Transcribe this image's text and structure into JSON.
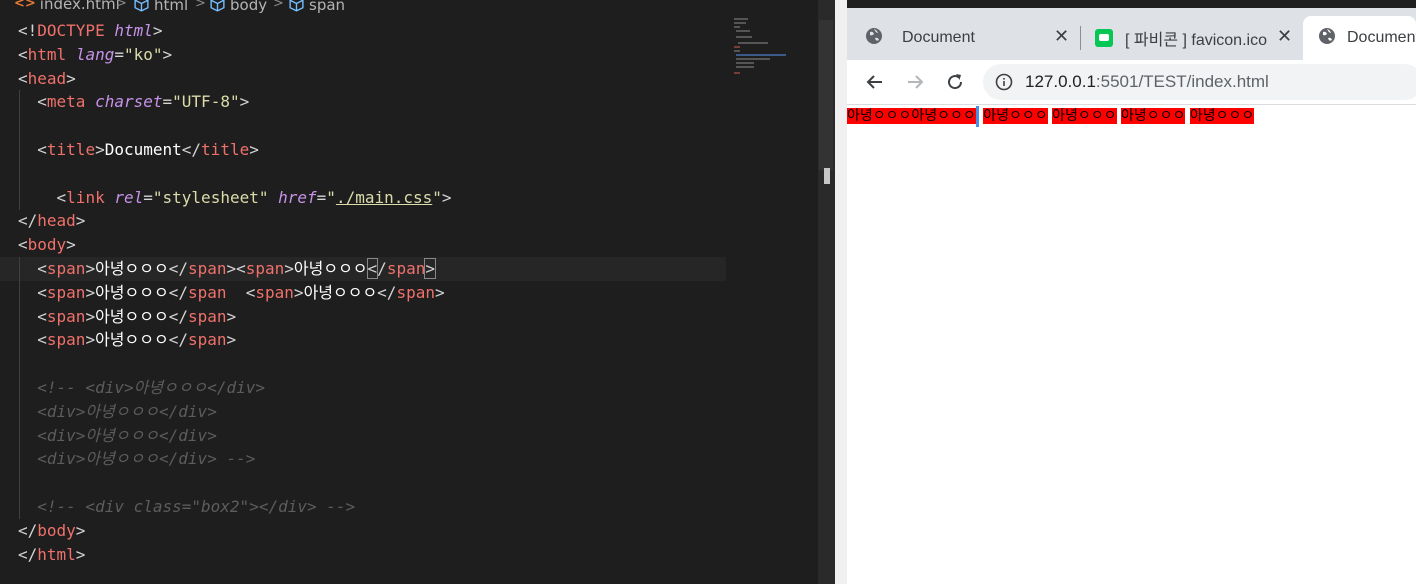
{
  "editor": {
    "breadcrumb": [
      "index.html",
      "html",
      "body",
      "span"
    ],
    "code_lines": [
      [
        [
          "p",
          "<!"
        ],
        [
          "t",
          "DOCTYPE"
        ],
        [
          "p",
          " "
        ],
        [
          "a",
          "html"
        ],
        [
          "p",
          ">"
        ]
      ],
      [
        [
          "p",
          "<"
        ],
        [
          "t",
          "html"
        ],
        [
          "p",
          " "
        ],
        [
          "a",
          "lang"
        ],
        [
          "p",
          "="
        ],
        [
          "s",
          "\"ko\""
        ],
        [
          "p",
          ">"
        ]
      ],
      [
        [
          "p",
          "<"
        ],
        [
          "t",
          "head"
        ],
        [
          "p",
          ">"
        ]
      ],
      [
        [
          "p",
          "  <"
        ],
        [
          "t",
          "meta"
        ],
        [
          "p",
          " "
        ],
        [
          "a",
          "charset"
        ],
        [
          "p",
          "="
        ],
        [
          "s",
          "\"UTF-8\""
        ],
        [
          "p",
          ">"
        ]
      ],
      [],
      [
        [
          "p",
          "  <"
        ],
        [
          "t",
          "title"
        ],
        [
          "p",
          ">"
        ],
        [
          "w",
          "Document"
        ],
        [
          "p",
          "</"
        ],
        [
          "t",
          "title"
        ],
        [
          "p",
          ">"
        ]
      ],
      [],
      [
        [
          "p",
          "    <"
        ],
        [
          "t",
          "link"
        ],
        [
          "p",
          " "
        ],
        [
          "a",
          "rel"
        ],
        [
          "p",
          "="
        ],
        [
          "s",
          "\"stylesheet\""
        ],
        [
          "p",
          " "
        ],
        [
          "a",
          "href"
        ],
        [
          "p",
          "="
        ],
        [
          "s",
          "\""
        ],
        [
          "u",
          "./main.css"
        ],
        [
          "s",
          "\""
        ],
        [
          "p",
          ">"
        ]
      ],
      [
        [
          "p",
          "</"
        ],
        [
          "t",
          "head"
        ],
        [
          "p",
          ">"
        ]
      ],
      [
        [
          "p",
          "<"
        ],
        [
          "t",
          "body"
        ],
        [
          "p",
          ">"
        ]
      ],
      [
        [
          "p",
          "  <"
        ],
        [
          "t",
          "span"
        ],
        [
          "p",
          ">"
        ],
        [
          "w",
          "아녕ㅇㅇㅇ"
        ],
        [
          "p",
          "</"
        ],
        [
          "t",
          "span"
        ],
        [
          "p",
          "><"
        ],
        [
          "t",
          "span"
        ],
        [
          "p",
          ">"
        ],
        [
          "w",
          "아녕ㅇㅇㅇ"
        ],
        [
          "x",
          "<"
        ],
        [
          "p",
          "/"
        ],
        [
          "t",
          "span"
        ],
        [
          "x",
          ">"
        ]
      ],
      [
        [
          "p",
          "  <"
        ],
        [
          "t",
          "span"
        ],
        [
          "p",
          ">"
        ],
        [
          "w",
          "아녕ㅇㅇㅇ"
        ],
        [
          "p",
          "</"
        ],
        [
          "t",
          "span"
        ],
        [
          "p",
          "  <"
        ],
        [
          "t",
          "span"
        ],
        [
          "p",
          ">"
        ],
        [
          "w",
          "아녕ㅇㅇㅇ"
        ],
        [
          "p",
          "</"
        ],
        [
          "t",
          "span"
        ],
        [
          "p",
          ">"
        ]
      ],
      [
        [
          "p",
          "  <"
        ],
        [
          "t",
          "span"
        ],
        [
          "p",
          ">"
        ],
        [
          "w",
          "아녕ㅇㅇㅇ"
        ],
        [
          "p",
          "</"
        ],
        [
          "t",
          "span"
        ],
        [
          "p",
          ">"
        ]
      ],
      [
        [
          "p",
          "  <"
        ],
        [
          "t",
          "span"
        ],
        [
          "p",
          ">"
        ],
        [
          "w",
          "아녕ㅇㅇㅇ"
        ],
        [
          "p",
          "</"
        ],
        [
          "t",
          "span"
        ],
        [
          "p",
          ">"
        ]
      ],
      [],
      [
        [
          "c",
          "  <!-- <div>아녕ㅇㅇㅇ</div>"
        ]
      ],
      [
        [
          "c",
          "  <div>아녕ㅇㅇㅇ</div>"
        ]
      ],
      [
        [
          "c",
          "  <div>아녕ㅇㅇㅇ</div>"
        ]
      ],
      [
        [
          "c",
          "  <div>아녕ㅇㅇㅇ</div> -->"
        ]
      ],
      [],
      [
        [
          "c",
          "  <!-- <div class=\"box2\"></div> -->"
        ]
      ],
      [
        [
          "p",
          "</"
        ],
        [
          "t",
          "body"
        ],
        [
          "p",
          ">"
        ]
      ],
      [
        [
          "p",
          "</"
        ],
        [
          "t",
          "html"
        ],
        [
          "p",
          ">"
        ]
      ]
    ],
    "active_line": 10
  },
  "browser": {
    "tabs": [
      {
        "title": "Document",
        "icon": "globe-icon",
        "close": "✕"
      },
      {
        "title": "[ 파비콘 ] favicon.ico",
        "icon": "line-app-icon",
        "close": "✕"
      },
      {
        "title": "Document",
        "icon": "globe-icon"
      }
    ],
    "url_host": "127.0.0.1",
    "url_rest": ":5501/TEST/index.html",
    "page_spans": [
      "아녕ㅇㅇㅇ",
      "아녕ㅇㅇㅇ",
      "아녕ㅇㅇㅇ",
      "아녕ㅇㅇㅇ",
      "아녕ㅇㅇㅇ",
      "아녕ㅇㅇㅇ"
    ],
    "span_background": "#ff0000"
  }
}
